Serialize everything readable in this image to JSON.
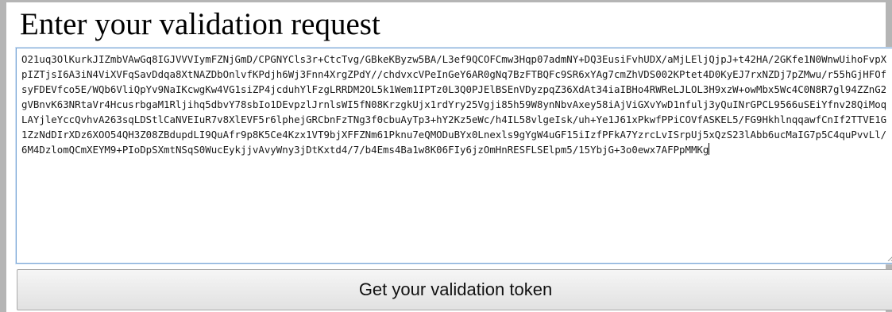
{
  "form": {
    "title": "Enter your validation request",
    "request_text": "O21uq3OlKurkJIZmbVAwGq8IGJVVVIymFZNjGmD/CPGNYCls3r+CtcTvg/GBkeKByzw5BA/L3ef9QCOFCmw3Hqp07admNY+DQ3EusiFvhUDX/aMjLEljQjpJ+t42HA/2GKfe1N0WnwUihoFvpXpIZTjsI6A3iN4ViXVFqSavDdqa8XtNAZDbOnlvfKPdjh6Wj3Fnn4XrgZPdY//chdvxcVPeInGeY6AR0gNq7BzFTBQFc9SR6xYAg7cmZhVDS002KPtet4D0KyEJ7rxNZDj7pZMwu/r55hGjHFOfsyFDEVfco5E/WQb6VliQpYv9NaIKcwgKw4VG1siZP4jcduhYlFzgLRRDM2OL5k1Wem1IPTz0L3Q0PJElBSEnVDyzpqZ36XdAt34iaIBHo4RWReLJLOL3H9xzW+owMbx5Wc4C0N8R7gl94ZZnG2gVBnvK63NRtaVr4HcusrbgaM1Rljihq5dbvY78sbIo1DEvpzlJrnlsWI5fN08KrzgkUjx1rdYry25Vgji85h59W8ynNbvAxey58iAjViGXvYwD1nfulj3yQuINrGPCL9566uSEiYfnv28QiMoqLAYjleYccQvhvA263sqLDStlCaNVEIuR7v8XlEVF5r6lphejGRCbnFzTNg3f0cbuAyTp3+hY2Kz5eWc/h4IL58vlgeIsk/uh+Ye1J61xPkwfPPiCOVfASKEL5/FG9HkhlnqqawfCnIf2TTVE1G1ZzNdDIrXDz6XOO54QH3Z08ZBdupdLI9QuAfr9p8K5Ce4Kzx1VT9bjXFFZNm61Pknu7eQMODuBYx0Lnexls9gYgW4uGF15iIzfPFkA7YzrcLvISrpUj5xQzS23lAbb6ucMaIG7p5C4quPvvLl/6M4DzlomQCmXEYM9+PIoDpSXmtNSqS0WucEykjjvAvyWny3jDtKxtd4/7/b4Ems4Ba1w8K06FIy6jzOmHnRESFLSElpm5/15YbjG+3o0ewx7AFPpMMKg",
    "submit_label": "Get your validation token"
  }
}
